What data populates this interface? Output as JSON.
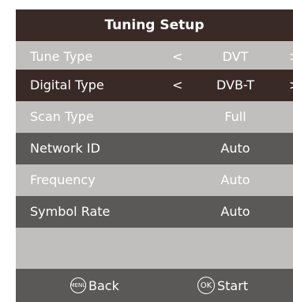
{
  "title": "Tuning Setup",
  "rows": [
    {
      "label": "Tune Type",
      "value": "DVT",
      "arrow_left": "<",
      "arrow_right": ">"
    },
    {
      "label": "Digital Type",
      "value": "DVB-T",
      "arrow_left": "<",
      "arrow_right": ">"
    },
    {
      "label": "Scan Type",
      "value": "Full"
    },
    {
      "label": "Network ID",
      "value": "Auto"
    },
    {
      "label": "Frequency",
      "value": "Auto"
    },
    {
      "label": "Symbol Rate",
      "value": "Auto"
    }
  ],
  "footer": {
    "back_icon_text": "MENU",
    "back_label": "Back",
    "start_icon_text": "OK",
    "start_label": "Start"
  }
}
